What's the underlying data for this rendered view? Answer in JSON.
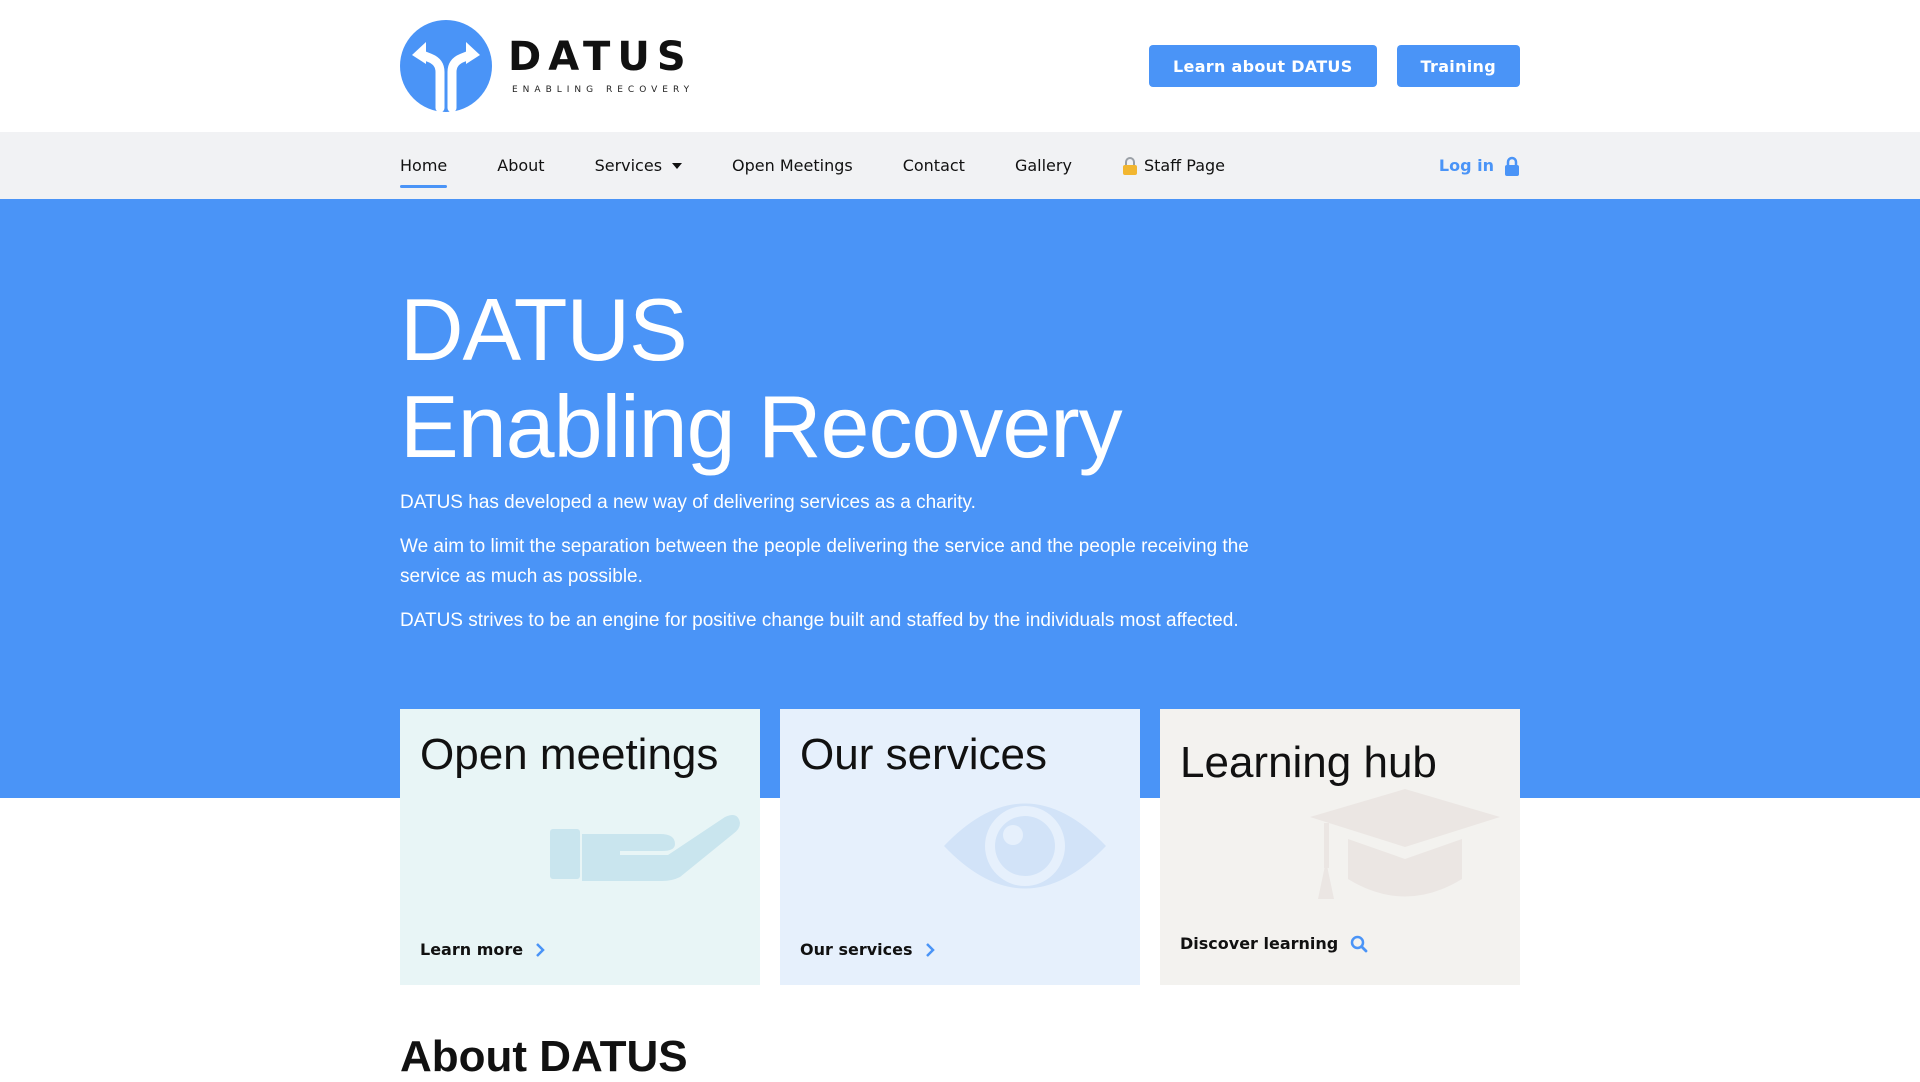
{
  "header": {
    "logo_word": "DATUS",
    "logo_tagline": "ENABLING RECOVERY",
    "buttons": [
      "Learn about DATUS",
      "Training"
    ]
  },
  "nav": {
    "items": [
      {
        "label": "Home",
        "active": true
      },
      {
        "label": "About"
      },
      {
        "label": "Services",
        "dropdown": true
      },
      {
        "label": "Open Meetings"
      },
      {
        "label": "Contact"
      },
      {
        "label": "Gallery"
      },
      {
        "label": "Staff Page",
        "icon": "lock-emoji-icon"
      }
    ],
    "login": "Log in"
  },
  "hero": {
    "title_line1": "DATUS",
    "title_line2": "Enabling Recovery",
    "paragraphs": [
      "DATUS has developed a new way of delivering services as a charity.",
      "We aim to limit the separation between the people delivering the service and the people receiving the service as much as possible.",
      "DATUS strives to be an engine for positive change built and staffed by the individuals most affected."
    ]
  },
  "cards": [
    {
      "title": "Open meetings",
      "link": "Learn more",
      "icon": "hand-icon",
      "bg": "#e8f5f6"
    },
    {
      "title": "Our services",
      "link": "Our services",
      "icon": "eye-icon",
      "bg": "#e6f0fc"
    },
    {
      "title": "Learning hub",
      "link": "Discover learning",
      "icon": "graduation-cap-icon",
      "bg": "#f3f2ef"
    }
  ],
  "about": {
    "title": "About DATUS"
  },
  "colors": {
    "accent": "#4a94f7"
  }
}
